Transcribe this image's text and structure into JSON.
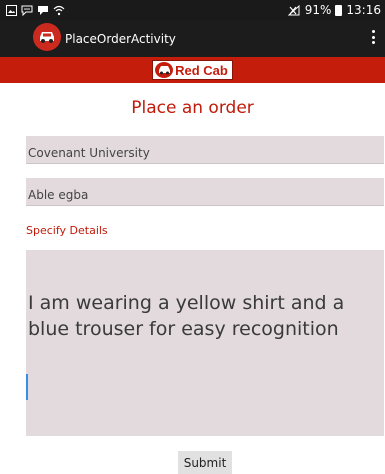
{
  "status_bar": {
    "notification_icons": [
      "image-icon",
      "chat-icon",
      "message-icon",
      "wifi-icon"
    ],
    "signal_icon": "no-signal-icon",
    "battery_percent": "91%",
    "time": "13:16"
  },
  "action_bar": {
    "title": "PlaceOrderActivity",
    "icon": "red-cab-logo-icon"
  },
  "brand": {
    "text": "Red Cab"
  },
  "page": {
    "title": "Place an order"
  },
  "form": {
    "destination_value": "Covenant University",
    "pickup_value": "Able egba",
    "details_label": "Specify Details",
    "details_value": "I am wearing a yellow shirt and a blue trouser for easy recognition",
    "submit_label": "Submit"
  },
  "colors": {
    "brand_red": "#c51d0c",
    "field_bg": "#e2dadd",
    "action_bar_bg": "#1c1c1c"
  }
}
